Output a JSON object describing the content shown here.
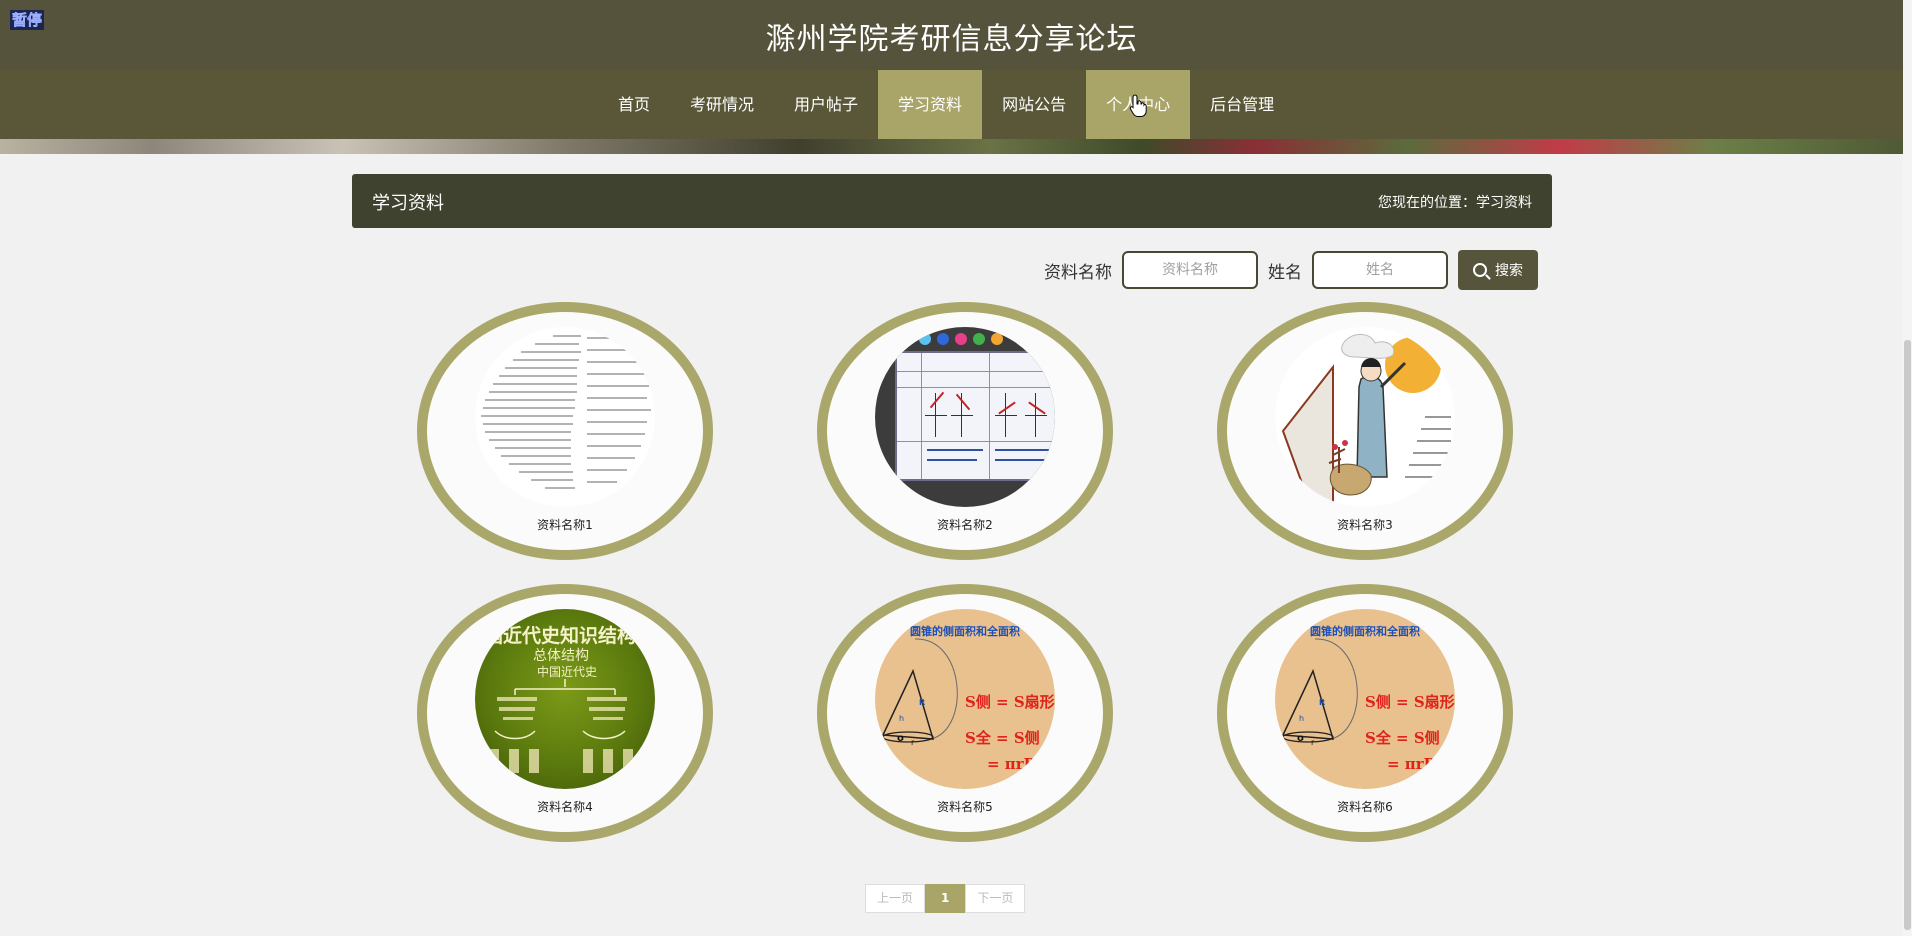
{
  "overlay": {
    "pause_label": "暂停"
  },
  "header": {
    "title": "滁州学院考研信息分享论坛"
  },
  "nav": {
    "items": [
      {
        "label": "首页",
        "active": false
      },
      {
        "label": "考研情况",
        "active": false
      },
      {
        "label": "用户帖子",
        "active": false
      },
      {
        "label": "学习资料",
        "active": true
      },
      {
        "label": "网站公告",
        "active": false
      },
      {
        "label": "个人中心",
        "active": true
      },
      {
        "label": "后台管理",
        "active": false
      }
    ]
  },
  "section": {
    "title": "学习资料",
    "breadcrumb": "您现在的位置：学习资料"
  },
  "search": {
    "name_label": "资料名称",
    "name_placeholder": "资料名称",
    "person_label": "姓名",
    "person_placeholder": "姓名",
    "button_label": "搜索"
  },
  "materials": [
    {
      "caption": "资料名称1",
      "thumbnail": "vocabulary-text-page"
    },
    {
      "caption": "资料名称2",
      "thumbnail": "math-function-table-board"
    },
    {
      "caption": "资料名称3",
      "thumbnail": "scholar-illustration"
    },
    {
      "caption": "资料名称4",
      "thumbnail": "history-knowledge-structure",
      "image_text": {
        "title": "中国近代史知识结构",
        "sub1": "总体结构",
        "sub2": "中国近代史"
      }
    },
    {
      "caption": "资料名称5",
      "thumbnail": "cone-area-formula",
      "image_text": {
        "title": "圆锥的侧面积和全面积",
        "f1": "S侧 = S扇形 = πrR",
        "f2": "S全 = S侧 + S底",
        "f3": "= πrR"
      }
    },
    {
      "caption": "资料名称6",
      "thumbnail": "cone-area-formula",
      "image_text": {
        "title": "圆锥的侧面积和全面积",
        "f1": "S侧 = S扇形 = πrR",
        "f2": "S全 = S侧 + S底",
        "f3": "= πrR"
      }
    }
  ],
  "pagination": {
    "prev_label": "上一页",
    "current_page": "1",
    "next_label": "下一页"
  },
  "colors": {
    "header_bg": "#55533b",
    "nav_bg": "#595738",
    "accent": "#a9a568",
    "section_bg": "#404230",
    "card_border": "#a9a76a"
  }
}
